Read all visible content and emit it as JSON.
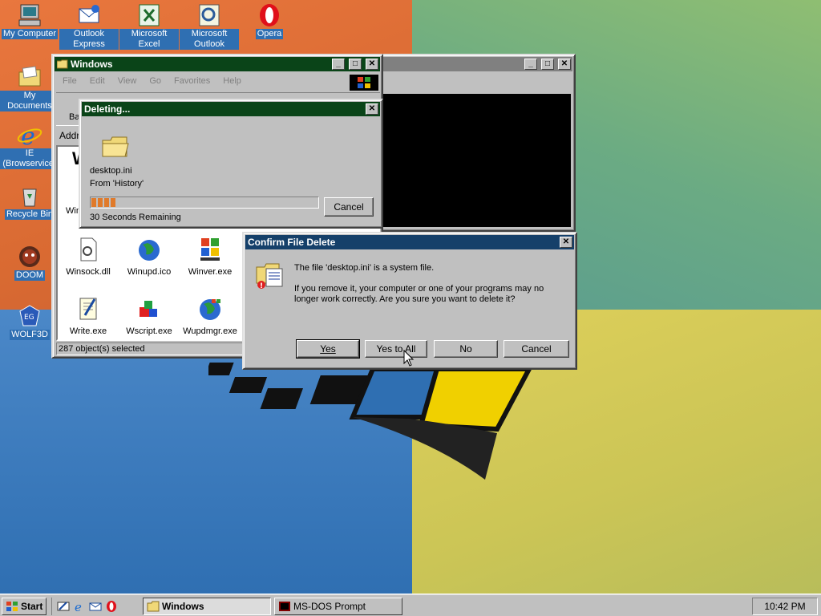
{
  "desktop": {
    "icons": [
      {
        "label": "My Computer",
        "icon": "my-computer-icon"
      },
      {
        "label": "Outlook Express",
        "icon": "outlook-express-icon"
      },
      {
        "label": "Microsoft Excel",
        "icon": "excel-icon"
      },
      {
        "label": "Microsoft Outlook",
        "icon": "outlook-icon"
      },
      {
        "label": "Opera",
        "icon": "opera-icon"
      },
      {
        "label": "My Documents",
        "icon": "my-documents-icon"
      },
      {
        "label": "IE (Browservice)",
        "icon": "internet-explorer-icon"
      },
      {
        "label": "Recycle Bin",
        "icon": "recycle-bin-icon"
      },
      {
        "label": "DOOM",
        "icon": "doom-icon"
      },
      {
        "label": "WOLF3D",
        "icon": "wolf3d-icon"
      }
    ]
  },
  "explorer": {
    "title": "Windows",
    "menu": [
      "File",
      "Edit",
      "View",
      "Go",
      "Favorites",
      "Help"
    ],
    "back_label": "Ba",
    "address_label": "Addr",
    "heading_letter": "W",
    "partial_item_label": "Win",
    "files": [
      {
        "name": "Winsock.dll",
        "icon": "dll-file-icon"
      },
      {
        "name": "Winupd.ico",
        "icon": "globe-icon"
      },
      {
        "name": "Winver.exe",
        "icon": "windows-flag-icon"
      },
      {
        "name": "Write.exe",
        "icon": "write-icon"
      },
      {
        "name": "Wscript.exe",
        "icon": "wscript-icon"
      },
      {
        "name": "Wupdmgr.exe",
        "icon": "windows-update-icon"
      }
    ],
    "status": "287 object(s) selected"
  },
  "deleting": {
    "title": "Deleting...",
    "file": "desktop.ini",
    "from": "From 'History'",
    "remaining": "30 Seconds Remaining",
    "progress": 0.11,
    "cancel_label": "Cancel"
  },
  "confirm": {
    "title": "Confirm File Delete",
    "line1": "The file 'desktop.ini' is a system file.",
    "line2": "If you remove it, your computer or one of your programs may no longer work correctly. Are you sure you want to delete it?",
    "yes_label": "Yes",
    "yes_to_all_label": "Yes to All",
    "no_label": "No",
    "cancel_label": "Cancel"
  },
  "taskbar": {
    "start_label": "Start",
    "items": [
      "Windows",
      "MS-DOS Prompt"
    ],
    "clock": "10:42 PM"
  },
  "colors": {
    "active_title": "#0a4418",
    "dialog_title": "#15406a",
    "progress": "#e07a2a"
  }
}
